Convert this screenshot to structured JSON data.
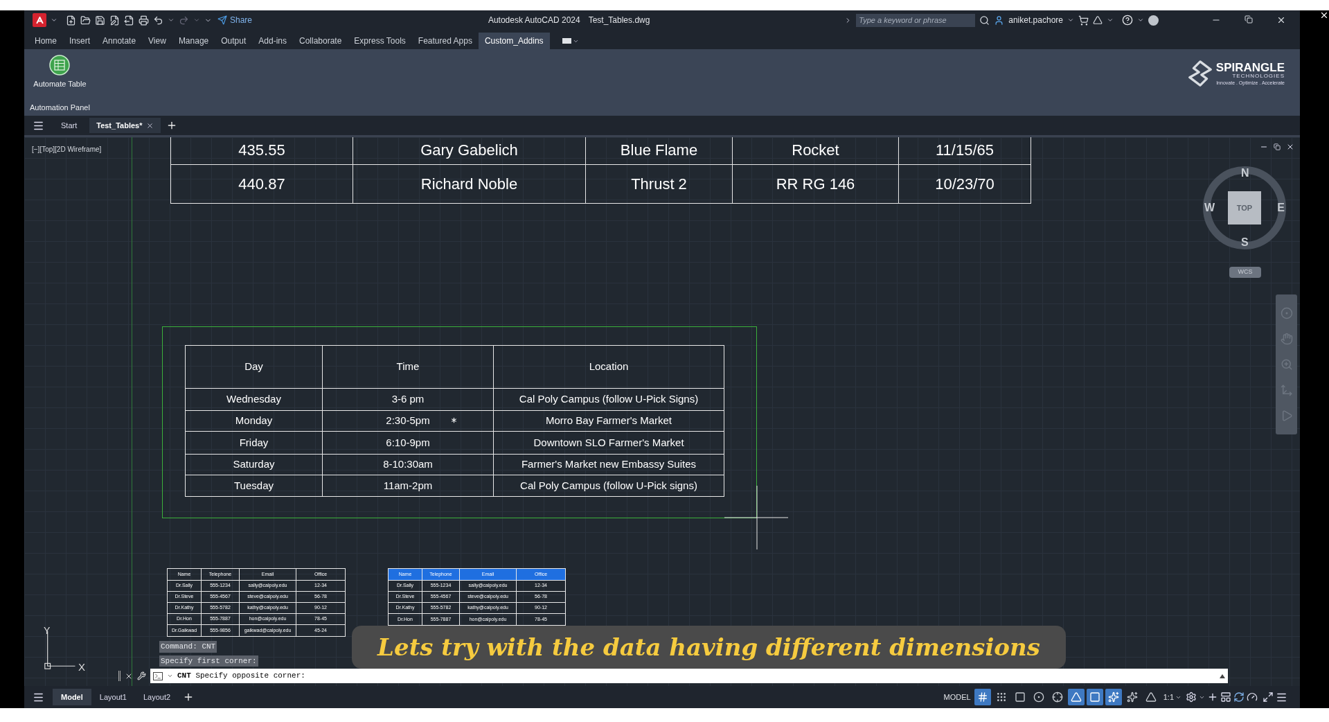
{
  "title_bar": {
    "app_title": "Autodesk AutoCAD 2024",
    "file_name": "Test_Tables.dwg",
    "share_label": "Share",
    "search": {
      "placeholder": "Type a keyword or phrase"
    },
    "user_name": "aniket.pachore"
  },
  "ribbon_tabs": [
    {
      "label": "Home",
      "selected": false
    },
    {
      "label": "Insert",
      "selected": false
    },
    {
      "label": "Annotate",
      "selected": false
    },
    {
      "label": "View",
      "selected": false
    },
    {
      "label": "Manage",
      "selected": false
    },
    {
      "label": "Output",
      "selected": false
    },
    {
      "label": "Add-ins",
      "selected": false
    },
    {
      "label": "Collaborate",
      "selected": false
    },
    {
      "label": "Express Tools",
      "selected": false
    },
    {
      "label": "Featured Apps",
      "selected": false
    },
    {
      "label": "Custom_Addins",
      "selected": true
    }
  ],
  "ribbon_panel": {
    "tool_label": "Automate Table",
    "panel_label": "Automation Panel",
    "logo": {
      "name": "SPIRANGLE",
      "subtitle": "TECHNOLOGIES",
      "tagline": "Innovate . Optimize . Accelerate"
    }
  },
  "file_tabs": [
    {
      "label": "Start",
      "selected": false,
      "closable": false
    },
    {
      "label": "Test_Tables*",
      "selected": true,
      "closable": true
    }
  ],
  "viewport": {
    "label": "[−][Top][2D Wireframe]",
    "view_cube": {
      "face": "TOP",
      "north": "N",
      "south": "S",
      "east": "E",
      "west": "W",
      "ucs": "WCS"
    },
    "ucs_axes": {
      "x": "X",
      "y": "Y"
    }
  },
  "records_table": {
    "rows": [
      [
        "435.55",
        "Gary Gabelich",
        "Blue Flame",
        "Rocket",
        "11/15/65"
      ],
      [
        "440.87",
        "Richard Noble",
        "Thrust 2",
        "RR RG 146",
        "10/23/70"
      ]
    ]
  },
  "schedule_table": {
    "columns": [
      "Day",
      "Time",
      "Location"
    ],
    "rows": [
      [
        "Wednesday",
        "3-6 pm",
        "Cal Poly Campus (follow U-Pick Signs)"
      ],
      [
        "Monday",
        "2:30-5pm",
        "Morro Bay Farmer's Market"
      ],
      [
        "Friday",
        "6:10-9pm",
        "Downtown SLO Farmer's Market"
      ],
      [
        "Saturday",
        "8-10:30am",
        "Farmer's Market new Embassy Suites"
      ],
      [
        "Tuesday",
        "11am-2pm",
        "Cal Poly Campus (follow U-Pick signs)"
      ]
    ]
  },
  "contacts_table": {
    "columns": [
      "Name",
      "Telephone",
      "Email",
      "Office"
    ],
    "rows": [
      [
        "Dr.Sally",
        "555-1234",
        "sally@calpoly.edu",
        "12-34"
      ],
      [
        "Dr.Steve",
        "555-4567",
        "steve@calpoly.edu",
        "56-78"
      ],
      [
        "Dr.Kathy",
        "555-5782",
        "kathy@calpoly.edu",
        "90-12"
      ],
      [
        "Dr.Hon",
        "555-7887",
        "hon@calpoly.edu",
        "78-45"
      ],
      [
        "Dr.Gaikwad",
        "555-9856",
        "gaikwad@calpoly.edu",
        "45-24"
      ]
    ]
  },
  "contacts_table_styled": {
    "columns": [
      "Name",
      "Telephone",
      "Email",
      "Office"
    ],
    "rows": [
      [
        "Dr.Sally",
        "555-1234",
        "sally@calpoly.edu",
        "12-34"
      ],
      [
        "Dr.Steve",
        "555-4567",
        "steve@calpoly.edu",
        "56-78"
      ],
      [
        "Dr.Kathy",
        "555-5782",
        "kathy@calpoly.edu",
        "90-12"
      ],
      [
        "Dr.Hon",
        "555-7887",
        "hon@calpoly.edu",
        "78-45"
      ]
    ]
  },
  "command_history": [
    "Command: CNT",
    "Specify first corner:"
  ],
  "command_line": {
    "value": "**CNT** Specify opposite corner:"
  },
  "caption": "Lets try with the data having different dimensions",
  "layout_tabs": [
    {
      "label": "Model",
      "selected": true
    },
    {
      "label": "Layout1",
      "selected": false
    },
    {
      "label": "Layout2",
      "selected": false
    }
  ],
  "status_bar": {
    "model_label": "MODEL",
    "scale_label": "1:1",
    "tools": [
      {
        "kind": "grid",
        "on": true
      },
      {
        "kind": "snap",
        "on": false
      },
      {
        "kind": "ortho",
        "on": false
      },
      {
        "kind": "polar",
        "on": false
      },
      {
        "kind": "isodraft",
        "on": false
      },
      {
        "kind": "osnap_tracking",
        "on": true
      },
      {
        "kind": "osnap",
        "on": true
      },
      {
        "kind": "annotation_visibility",
        "on": true
      },
      {
        "kind": "autoscale",
        "on": false
      },
      {
        "kind": "annotation_monitor",
        "on": false
      }
    ]
  }
}
